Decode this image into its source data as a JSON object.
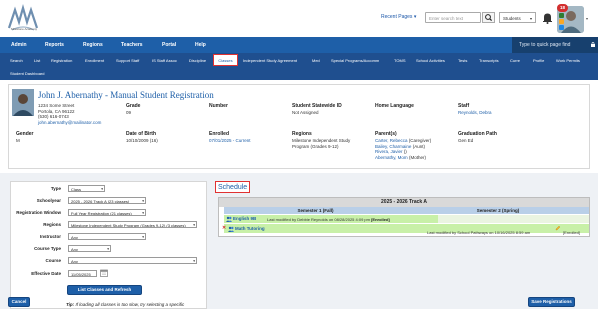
{
  "header": {
    "logo_text": "Milestone Academy",
    "recent_pages": "Recent Pages",
    "search_placeholder": "Enter search text",
    "search_scope": "Students",
    "notification_count": "18"
  },
  "main_nav": {
    "items": [
      "Admin",
      "Reports",
      "Regions",
      "Teachers",
      "Portal",
      "Help"
    ],
    "quick_page_placeholder": "Type to quick page find"
  },
  "sub_nav": {
    "row1": [
      "Search",
      "List",
      "Registration",
      "Enrollment",
      "Support Staff",
      "IS Staff Assoc",
      "Discipline",
      "Classes",
      "Independent Study Agreement",
      "Med",
      "Special Programs/Accomm",
      "TOMS",
      "School Activities",
      "Tests",
      "Transcripts",
      "Curre",
      "Profile",
      "Work Permits"
    ],
    "row2": [
      "Student Dashboard"
    ],
    "active": "Classes"
  },
  "student": {
    "name": "John J. Abernathy - Manual Student Registration",
    "address_lines": [
      "1234 Some Street",
      "Portola, CA 96122",
      "(530) 616-0743"
    ],
    "email": "john.abernathy@mailinator.com",
    "grade_label": "Grade",
    "grade": "09",
    "number_label": "Number",
    "ssid_label": "Student Statewide ID",
    "ssid": "Not Assigned",
    "home_language_label": "Home Language",
    "staff_label": "Staff",
    "staff": "Reynolds, Debra",
    "gender_label": "Gender",
    "gender": "M",
    "dob_label": "Date of Birth",
    "dob": "10/10/2009 (16)",
    "enrolled_label": "Enrolled",
    "enrolled": "07/01/2025 - Current",
    "regions_label": "Regions",
    "regions": [
      "Milestone Independent Study",
      "Program (Grades 9-12)"
    ],
    "parents_label": "Parent(s)",
    "parents": [
      {
        "name": "Carter, Rebecca",
        "rel": "(Caregiver)"
      },
      {
        "name": "Bailey, Charmaine",
        "rel": "(Aunt)"
      },
      {
        "name": "Rivera, Javier",
        "rel": "()"
      },
      {
        "name": "Abernathy, Mom",
        "rel": "(Mother)"
      }
    ],
    "graduation_path_label": "Graduation Path",
    "graduation_path": "Gen Ed"
  },
  "filters": {
    "type_label": "Type",
    "type_value": "Class",
    "schoolyear_label": "Schoolyear",
    "schoolyear_value": "2025 - 2026 Track A (23 classes)",
    "window_label": "Registration Window",
    "window_value": "Full Year Registration (21 classes)",
    "regions_label": "Regions",
    "regions_value": "Milestone Independent Study Program (Grades 9-12) (3 classes)",
    "instructor_label": "Instructor",
    "instructor_value": "Any",
    "course_type_label": "Course Type",
    "course_type_value": "Any",
    "course_label": "Course",
    "course_value": "Any",
    "effective_date_label": "Effective Date",
    "effective_date_value": "11/05/2025",
    "list_button": "List Classes and Refresh Schedule",
    "tip_label": "Tip:",
    "tip_text": "If loading all classes is too slow, try selecting a specific"
  },
  "schedule": {
    "title": "Schedule",
    "track": "2025 - 2026 Track A",
    "semester1": "Semester 1 (Fall)",
    "semester2": "Semester 2 (Spring)",
    "classes": [
      {
        "name": "English 9B",
        "note": "Last modified by Debbie Reynolds on 08/28/2025 4:09 pm",
        "status": "[Enrolled]"
      },
      {
        "name": "Math Tutoring",
        "note": "Last modified by School Pathways on 10/16/2025 8:59 am",
        "status": "[Enrolled]"
      }
    ]
  },
  "actions": {
    "cancel": "Cancel",
    "save": "Save Registrations"
  }
}
